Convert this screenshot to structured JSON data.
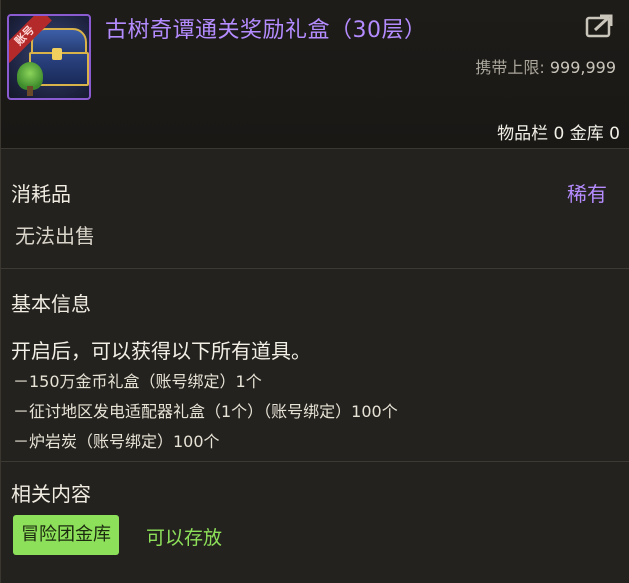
{
  "item": {
    "title": "古树奇谭通关奖励礼盒（30层）",
    "badge": "账号",
    "carry_limit_label": "携带上限:",
    "carry_limit_value": "999,999",
    "storage": "物品栏 0 金库 0",
    "type": "消耗品",
    "rarity": "稀有",
    "sell_status": "无法出售"
  },
  "basic_info": {
    "title": "基本信息",
    "description": "开启后，可以获得以下所有道具。",
    "items": [
      "－150万金币礼盒（账号绑定）1个",
      "－征讨地区发电适配器礼盒（1个）（账号绑定）100个",
      "－炉岩炭（账号绑定）100个"
    ]
  },
  "related": {
    "title": "相关内容",
    "storage_button": "冒险团金库",
    "storage_status": "可以存放"
  },
  "colors": {
    "rarity_purple": "#b48cff",
    "storable_green": "#8de05a"
  },
  "icons": {
    "item_icon": "treasure-chest-icon",
    "share": "share-export-icon"
  }
}
